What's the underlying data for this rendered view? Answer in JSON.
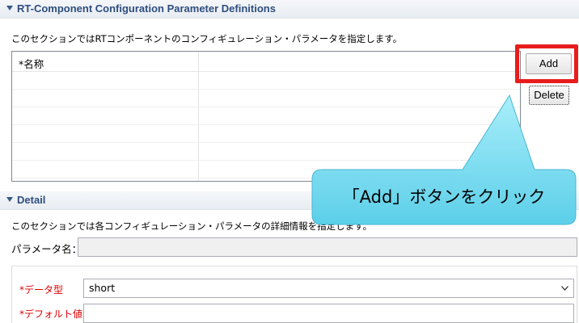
{
  "section1": {
    "title": "RT-Component Configuration Parameter Definitions",
    "description": "このセクションではRTコンポーネントのコンフィギュレーション・パラメータを指定します。",
    "table": {
      "column_name": "*名称"
    }
  },
  "buttons": {
    "add": "Add",
    "delete": "Delete"
  },
  "callout": {
    "text": "「Add」ボタンをクリック"
  },
  "section2": {
    "title": "Detail",
    "description": "このセクションでは各コンフィギュレーション・パラメータの詳細情報を指定します。",
    "param_name_label": "パラメータ名：",
    "data_type_label": "*データ型",
    "data_type_value": "short",
    "default_value_label": "*デフォルト値"
  },
  "colors": {
    "highlight": "#e81c1c",
    "callout_fill": "#7fdcf0",
    "section_title": "#2e4e7e"
  }
}
